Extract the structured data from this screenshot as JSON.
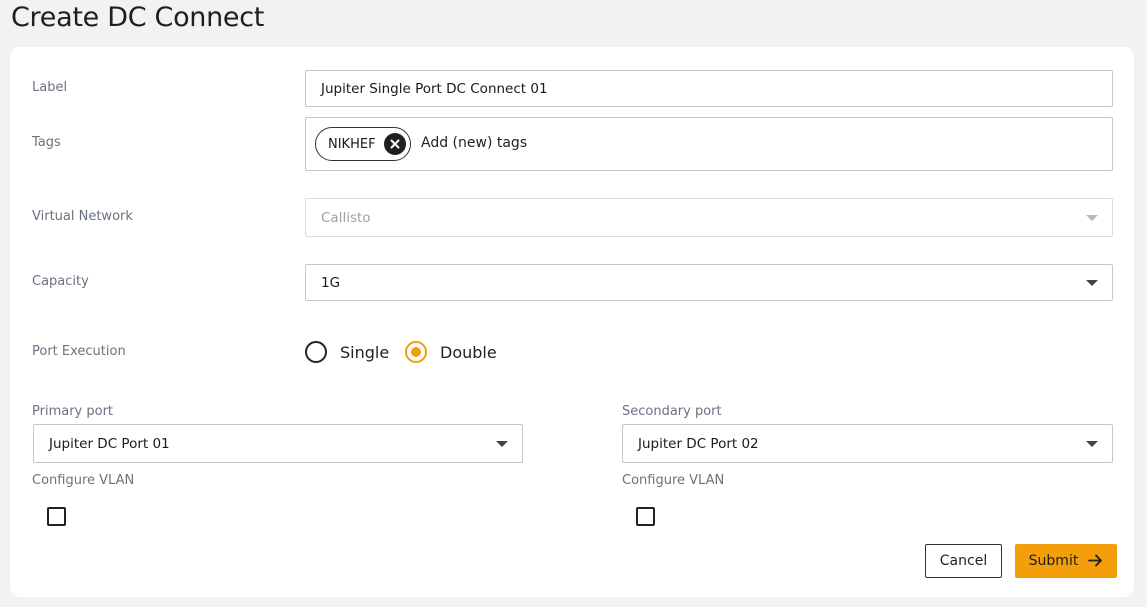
{
  "page": {
    "title": "Create DC Connect"
  },
  "form": {
    "label": {
      "label": "Label",
      "value": "Jupiter Single Port DC Connect 01"
    },
    "tags": {
      "label": "Tags",
      "chips": [
        "NIKHEF"
      ],
      "placeholder": "Add (new) tags"
    },
    "virtual_network": {
      "label": "Virtual Network",
      "value": "Callisto",
      "disabled": true
    },
    "capacity": {
      "label": "Capacity",
      "value": "1G"
    },
    "port_execution": {
      "label": "Port Execution",
      "options": [
        "Single",
        "Double"
      ],
      "selected": "Double"
    },
    "primary_port": {
      "label": "Primary port",
      "value": "Jupiter DC Port 01",
      "vlan_label": "Configure VLAN",
      "vlan_checked": false
    },
    "secondary_port": {
      "label": "Secondary port",
      "value": "Jupiter DC Port 02",
      "vlan_label": "Configure VLAN",
      "vlan_checked": false
    }
  },
  "actions": {
    "cancel_label": "Cancel",
    "submit_label": "Submit",
    "submit_color": "#f59e0b"
  },
  "icons": {
    "tag_remove": "close-circle-icon",
    "submit_arrow": "arrow-right-icon",
    "dropdown": "caret-down-icon"
  }
}
